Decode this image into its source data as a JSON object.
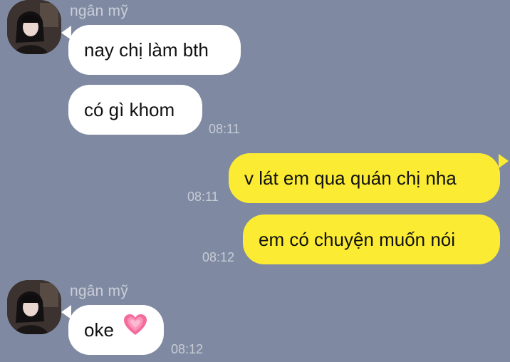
{
  "messages": [
    {
      "sender": "ngân mỹ",
      "text": "nay chị làm bth",
      "time": ""
    },
    {
      "sender": "",
      "text": "có gì khom",
      "time": "08:11"
    },
    {
      "sender": "me",
      "text": "v lát em qua quán chị nha",
      "time": "08:11"
    },
    {
      "sender": "me",
      "text": "em có chuyện muốn nói",
      "time": "08:12"
    },
    {
      "sender": "ngân mỹ",
      "text": "oke",
      "emoji": "growing-heart",
      "time": "08:12"
    }
  ],
  "contact": {
    "name": "ngân mỹ",
    "avatar_icon": "avatar-photo"
  },
  "colors": {
    "background": "#7f8aa2",
    "incoming_bubble": "#ffffff",
    "outgoing_bubble": "#fbec33",
    "timestamp": "#c7ccd6",
    "sender_name": "#c9ced9"
  }
}
